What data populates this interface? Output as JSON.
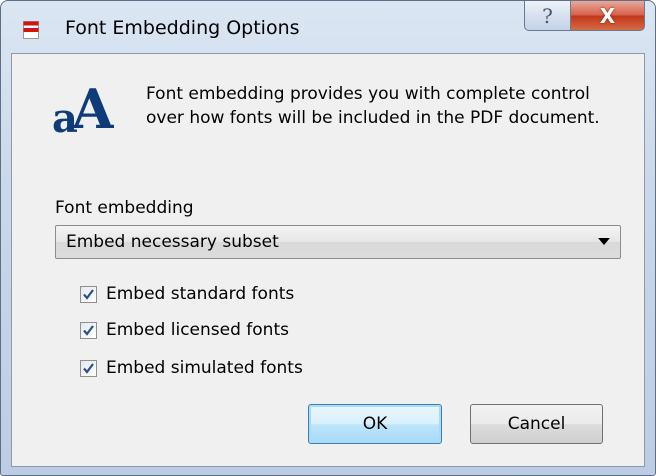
{
  "window": {
    "title": "Font Embedding Options",
    "help_glyph": "?",
    "close_glyph": "X",
    "icons": {
      "title": "pdf-document-icon",
      "app": "font-aA-icon"
    }
  },
  "content": {
    "description": "Font embedding provides you with complete control over how fonts will be included in the PDF document.",
    "font_embedding_label": "Font embedding",
    "font_embedding_value": "Embed necessary subset",
    "app_icon_glyphs": {
      "small": "a",
      "large": "A"
    },
    "checkboxes": [
      {
        "label": "Embed standard fonts",
        "checked": true
      },
      {
        "label": "Embed licensed fonts",
        "checked": true
      },
      {
        "label": "Embed simulated fonts",
        "checked": true
      }
    ]
  },
  "buttons": {
    "ok": "OK",
    "cancel": "Cancel"
  },
  "colors": {
    "title_icon_red": "#d1140e",
    "app_icon_blue": "#0f3c78",
    "ok_border": "#3c7fb1",
    "check_mark": "#2b4f8a"
  }
}
